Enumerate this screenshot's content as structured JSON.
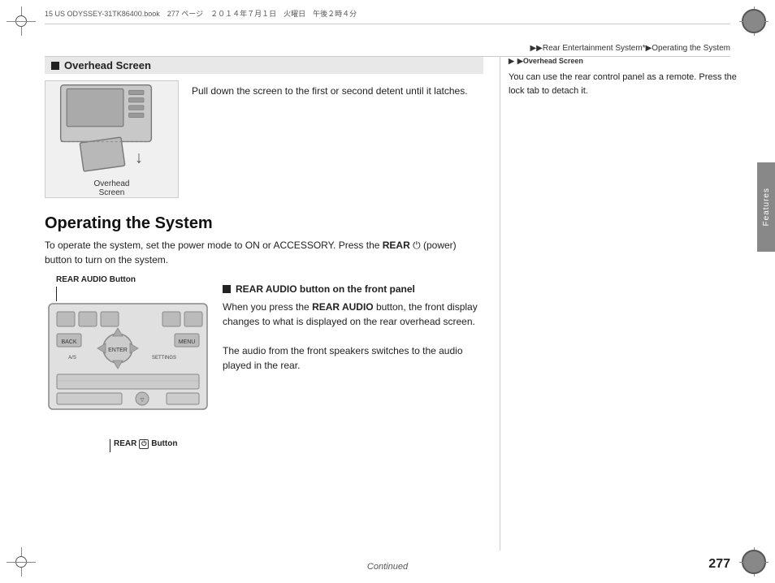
{
  "meta": {
    "file_info": "15 US ODYSSEY-31TK86400.book　277 ページ　２０１４年７月１日　火曜日　午後２時４分",
    "breadcrumb": "▶▶Rear Entertainment System*▶Operating the System"
  },
  "sections": {
    "overhead_screen": {
      "heading": "Overhead Screen",
      "description": "Pull down the screen to the first or second detent until it latches.",
      "label_text": "Overhead\nScreen"
    },
    "operating_system": {
      "heading": "Operating the System",
      "intro_normal": "To operate the system, set the power mode to ON or ACCESSORY. Press the ",
      "intro_bold": "REAR",
      "intro_normal2": " (power) button to turn on the system.",
      "rear_audio_heading_prefix": "■ ",
      "rear_audio_heading": "REAR AUDIO button on the front panel",
      "rear_audio_text1_normal": "When you press the ",
      "rear_audio_text1_bold": "REAR AUDIO",
      "rear_audio_text1_rest": " button, the front display changes to what is displayed on the rear overhead screen.",
      "rear_audio_text2": "The audio from the front speakers switches to the audio played in the rear.",
      "label_top": "REAR AUDIO Button",
      "label_bottom": "REAR  Button"
    },
    "right_panel": {
      "section_label": "▶Overhead Screen",
      "content": "You can use the rear control panel as a remote. Press the lock tab to detach it."
    }
  },
  "footer": {
    "continued": "Continued",
    "page": "277"
  },
  "sidebar": {
    "label": "Features"
  }
}
